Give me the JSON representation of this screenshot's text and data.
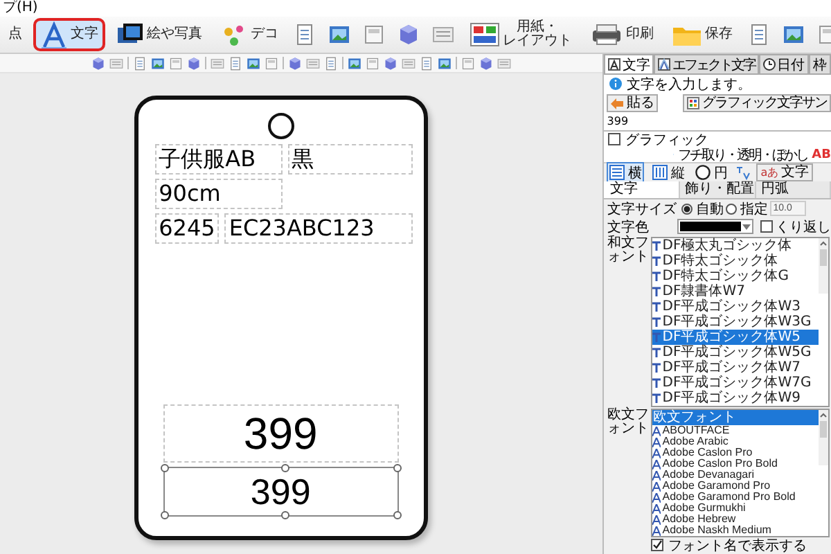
{
  "menu_fragment": "プ(H)",
  "toolbar": [
    {
      "kind": "button",
      "label": "点",
      "selected": false
    },
    {
      "kind": "button",
      "label": "文字",
      "selected": true
    },
    {
      "kind": "button",
      "label": "絵や写真",
      "selected": false
    },
    {
      "kind": "button",
      "label": "デコ",
      "selected": false
    },
    {
      "kind": "icon",
      "selected": false
    },
    {
      "kind": "icon",
      "selected": false
    },
    {
      "kind": "icon",
      "selected": false
    },
    {
      "kind": "icon",
      "selected": false
    },
    {
      "kind": "icon",
      "selected": false
    },
    {
      "kind": "button",
      "lines": [
        "用紙・",
        "レイアウト"
      ],
      "selected": false
    },
    {
      "kind": "button",
      "label": "印刷",
      "selected": false
    },
    {
      "kind": "button",
      "label": "保存",
      "selected": false
    },
    {
      "kind": "icon",
      "selected": false
    },
    {
      "kind": "icon",
      "selected": false
    },
    {
      "kind": "icon",
      "selected": false
    }
  ],
  "tag": {
    "rows": [
      {
        "fields": [
          {
            "text": "子供服AB"
          },
          {
            "text": "黒"
          }
        ]
      },
      {
        "fields": [
          {
            "text": "90cm"
          }
        ]
      },
      {
        "fields": [
          {
            "text": "6245"
          },
          {
            "text": "EC23ABC123"
          }
        ]
      }
    ],
    "prices": [
      {
        "text": "399",
        "selected": false
      },
      {
        "text": "399",
        "selected": true
      }
    ]
  },
  "panel": {
    "tabs": [
      {
        "label": "文字",
        "selected": true
      },
      {
        "label": "エフェクト文字",
        "selected": false
      },
      {
        "label": "日付",
        "selected": false
      },
      {
        "label": "枠",
        "selected": false
      }
    ],
    "hint": "文字を入力します。",
    "paste_button": "貼る",
    "graphic_text_button": "グラフィック文字サン",
    "text_value": "399",
    "graphic_checkbox": {
      "label": "グラフィック",
      "checked": false
    },
    "effects_link": "フチ取り・透明・ぼかし",
    "effects_badge": "AB",
    "directions": [
      {
        "label": "横",
        "selected": true
      },
      {
        "label": "縦",
        "selected": false
      },
      {
        "label": "円",
        "selected": false
      }
    ],
    "char_button_icon": "aあ",
    "char_button": "文字",
    "subtabs": [
      {
        "label": "文字",
        "selected": true
      },
      {
        "label": "飾り・配置",
        "selected": false
      },
      {
        "label": "円弧",
        "selected": false
      }
    ],
    "size": {
      "label": "文字サイズ",
      "options": [
        {
          "label": "自動",
          "selected": true
        },
        {
          "label": "指定",
          "selected": false
        }
      ],
      "value": "10.0"
    },
    "color_row": {
      "label": "文字色",
      "color": "#000000",
      "repeat_label": "くり返し",
      "repeat_checked": false
    },
    "jp_fonts": {
      "label": "和文フォント",
      "items": [
        {
          "name": "DF極太丸ゴシック体",
          "selected": false
        },
        {
          "name": "DF特太ゴシック体",
          "selected": false
        },
        {
          "name": "DF特太ゴシック体G",
          "selected": false
        },
        {
          "name": "DF隷書体W7",
          "selected": false
        },
        {
          "name": "DF平成ゴシック体W3",
          "selected": false
        },
        {
          "name": "DF平成ゴシック体W3G",
          "selected": false
        },
        {
          "name": "DF平成ゴシック体W5",
          "selected": true
        },
        {
          "name": "DF平成ゴシック体W5G",
          "selected": false
        },
        {
          "name": "DF平成ゴシック体W7",
          "selected": false
        },
        {
          "name": "DF平成ゴシック体W7G",
          "selected": false
        },
        {
          "name": "DF平成ゴシック体W9",
          "selected": false
        }
      ]
    },
    "latin_fonts": {
      "label": "欧文フォント",
      "items": [
        {
          "name": "欧文フォント",
          "selected": true,
          "kind": "header"
        },
        {
          "name": "ABOUTFACE",
          "selected": false,
          "kind": "font"
        },
        {
          "name": "Adobe Arabic",
          "selected": false,
          "kind": "font"
        },
        {
          "name": "Adobe Caslon Pro",
          "selected": false,
          "kind": "font"
        },
        {
          "name": "Adobe Caslon Pro Bold",
          "selected": false,
          "kind": "font"
        },
        {
          "name": "Adobe Devanagari",
          "selected": false,
          "kind": "font"
        },
        {
          "name": "Adobe Garamond Pro",
          "selected": false,
          "kind": "font"
        },
        {
          "name": "Adobe Garamond Pro Bold",
          "selected": false,
          "kind": "font"
        },
        {
          "name": "Adobe Gurmukhi",
          "selected": false,
          "kind": "font"
        },
        {
          "name": "Adobe Hebrew",
          "selected": false,
          "kind": "font"
        },
        {
          "name": "Adobe Naskh Medium",
          "selected": false,
          "kind": "font"
        }
      ]
    },
    "show_names": {
      "label": "フォント名で表示する",
      "checked": true
    }
  }
}
